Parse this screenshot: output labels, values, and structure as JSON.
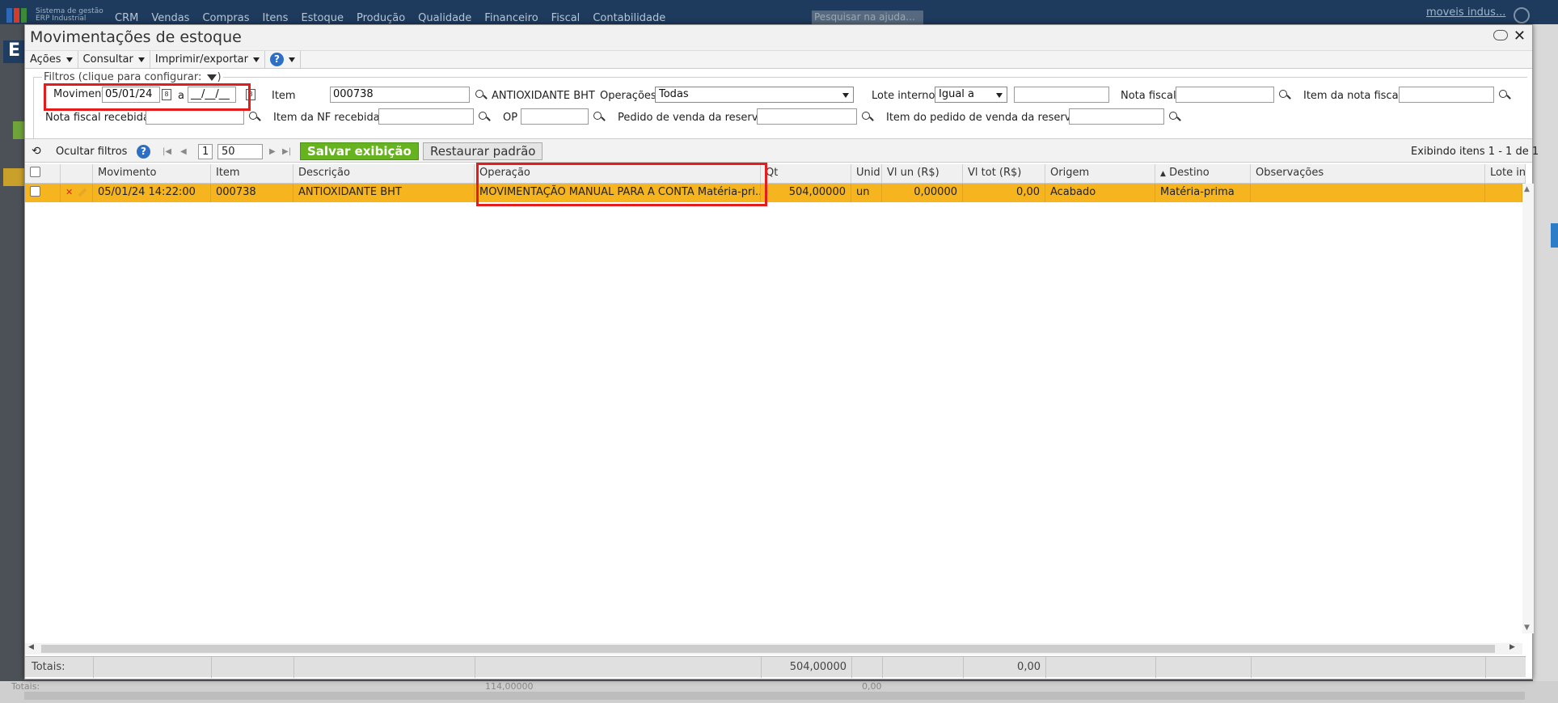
{
  "background": {
    "brand_line1": "Sistema de gestão",
    "brand_line2": "ERP Industrial",
    "menus": [
      "CRM",
      "Vendas",
      "Compras",
      "Itens",
      "Estoque",
      "Produção",
      "Qualidade",
      "Financeiro",
      "Fiscal",
      "Contabilidade"
    ],
    "search_placeholder": "Pesquisar na ajuda...",
    "user": "moveis indus...",
    "bottom_label": "Totais:",
    "bottom_value1": "114,00000",
    "bottom_value2": "0,00"
  },
  "window": {
    "title": "Movimentações de estoque"
  },
  "menubar": {
    "acoes": "Ações",
    "consultar": "Consultar",
    "imprimir": "Imprimir/exportar",
    "help": "?"
  },
  "filters": {
    "legend": "Filtros (clique para configurar:",
    "legend_end": ")",
    "movimento_label": "Movimento",
    "date_from": "05/01/24",
    "date_sep": "a",
    "date_to": "__/__/__",
    "item_label": "Item",
    "item_value": "000738",
    "item_desc": "ANTIOXIDANTE BHT",
    "operacoes_label": "Operações",
    "operacoes_value": "Todas",
    "lote_label": "Lote interno",
    "lote_op": "Igual a",
    "lote_value": "",
    "nota_label": "Nota fiscal",
    "nota_value": "",
    "item_nota_label": "Item da nota fiscal",
    "item_nota_value": "",
    "nf_recebida_label": "Nota fiscal recebida",
    "nf_recebida_value": "",
    "item_nf_recebida_label": "Item da NF recebida",
    "item_nf_recebida_value": "",
    "op_label": "OP",
    "op_value": "",
    "pedido_label": "Pedido de venda da reserva",
    "pedido_value": "",
    "item_pedido_label": "Item do pedido de venda da reserva",
    "item_pedido_value": ""
  },
  "toolbar": {
    "hide_filters": "Ocultar filtros",
    "page": "1",
    "page_size": "50",
    "save_view": "Salvar exibição",
    "restore_default": "Restaurar padrão",
    "showing": "Exibindo itens 1 - 1 de 1"
  },
  "grid": {
    "headers": {
      "movimento": "Movimento",
      "item": "Item",
      "descricao": "Descrição",
      "operacao": "Operação",
      "qt": "Qt",
      "unid": "Unid",
      "vl_un": "Vl un (R$)",
      "vl_tot": "Vl tot (R$)",
      "origem": "Origem",
      "destino": "Destino",
      "observacoes": "Observações",
      "lote": "Lote inte"
    },
    "rows": [
      {
        "movimento": "05/01/24 14:22:00",
        "item": "000738",
        "descricao": "ANTIOXIDANTE BHT",
        "operacao": "MOVIMENTAÇÃO MANUAL PARA A CONTA Matéria-pri...",
        "qt": "504,00000",
        "unid": "un",
        "vl_un": "0,00000",
        "vl_tot": "0,00",
        "origem": "Acabado",
        "destino": "Matéria-prima",
        "observacoes": "",
        "lote": ""
      }
    ],
    "totals": {
      "label": "Totais:",
      "qt": "504,00000",
      "vl_tot": "0,00"
    }
  },
  "colors": {
    "row_highlight": "#f6b51e",
    "save_button": "#67b21f",
    "annotation_box": "#e31c1c",
    "topbar": "#1e3a5c"
  }
}
